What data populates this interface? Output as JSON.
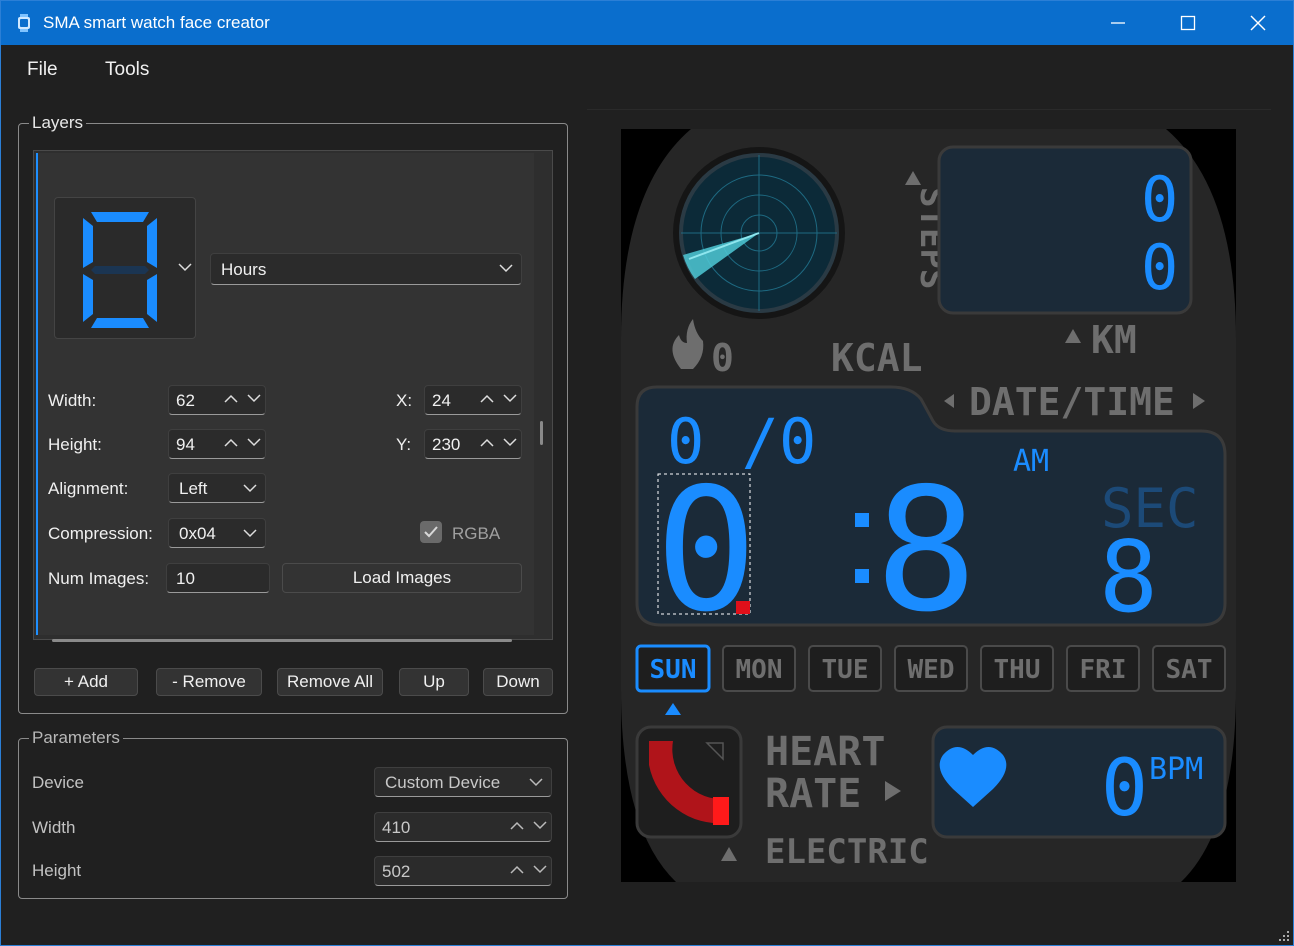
{
  "window": {
    "title": "SMA smart watch face creator"
  },
  "menu": {
    "file": "File",
    "tools": "Tools"
  },
  "layers": {
    "group_title": "Layers",
    "layer_type": "Hours",
    "width_label": "Width:",
    "width_value": "62",
    "height_label": "Height:",
    "height_value": "94",
    "x_label": "X:",
    "x_value": "24",
    "y_label": "Y:",
    "y_value": "230",
    "alignment_label": "Alignment:",
    "alignment_value": "Left",
    "compression_label": "Compression:",
    "compression_value": "0x04",
    "rgba_label": "RGBA",
    "num_images_label": "Num Images:",
    "num_images_value": "10",
    "load_images": "Load Images",
    "buttons": {
      "add": "+ Add",
      "remove": "- Remove",
      "remove_all": "Remove All",
      "up": "Up",
      "down": "Down"
    }
  },
  "parameters": {
    "group_title": "Parameters",
    "device_label": "Device",
    "device_value": "Custom Device",
    "width_label": "Width",
    "width_value": "410",
    "height_label": "Height",
    "height_value": "502"
  },
  "watch": {
    "steps_label": "STEPS",
    "steps_digits": [
      "0",
      "0"
    ],
    "km_label": "KM",
    "kcal_value": "0",
    "kcal_label": "KCAL",
    "datetime_label": "DATE/TIME",
    "date_text": "0 /0",
    "ampm": "AM",
    "hour_digit": "0",
    "minute_digit": "8",
    "sec_label": "SEC",
    "sec_digit": "8",
    "days": [
      "SUN",
      "MON",
      "TUE",
      "WED",
      "THU",
      "FRI",
      "SAT"
    ],
    "active_day": "SUN",
    "heart_label_1": "HEART",
    "heart_label_2": "RATE",
    "electric_label": "ELECTRIC",
    "bpm_value": "0",
    "bpm_label": "BPM",
    "accent": "#1a8cff",
    "dim": "#6e6e6e"
  }
}
